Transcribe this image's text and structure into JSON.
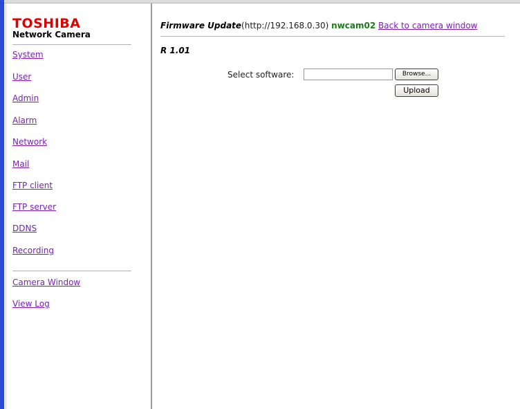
{
  "brand": {
    "name": "TOSHIBA",
    "subtitle": "Network Camera"
  },
  "sidebar": {
    "items": [
      {
        "label": "System"
      },
      {
        "label": "User"
      },
      {
        "label": "Admin"
      },
      {
        "label": "Alarm"
      },
      {
        "label": "Network"
      },
      {
        "label": "Mail"
      },
      {
        "label": "FTP client"
      },
      {
        "label": "FTP server"
      },
      {
        "label": "DDNS"
      },
      {
        "label": "Recording"
      }
    ],
    "secondary": [
      {
        "label": "Camera Window"
      },
      {
        "label": "View Log"
      }
    ]
  },
  "header": {
    "title": "Firmware Update",
    "url": "(http://192.168.0.30)",
    "camera_name": "nwcam02",
    "back_link": "Back to camera window"
  },
  "version": "R 1.01",
  "form": {
    "select_label": "Select software:",
    "file_value": "",
    "browse_label": "Browse...",
    "upload_label": "Upload"
  },
  "colors": {
    "brand_red": "#e00000",
    "link_purple": "#7a1fb5",
    "camera_name_green": "#1a7a1a",
    "frame_blue": "#2a4bd7"
  }
}
